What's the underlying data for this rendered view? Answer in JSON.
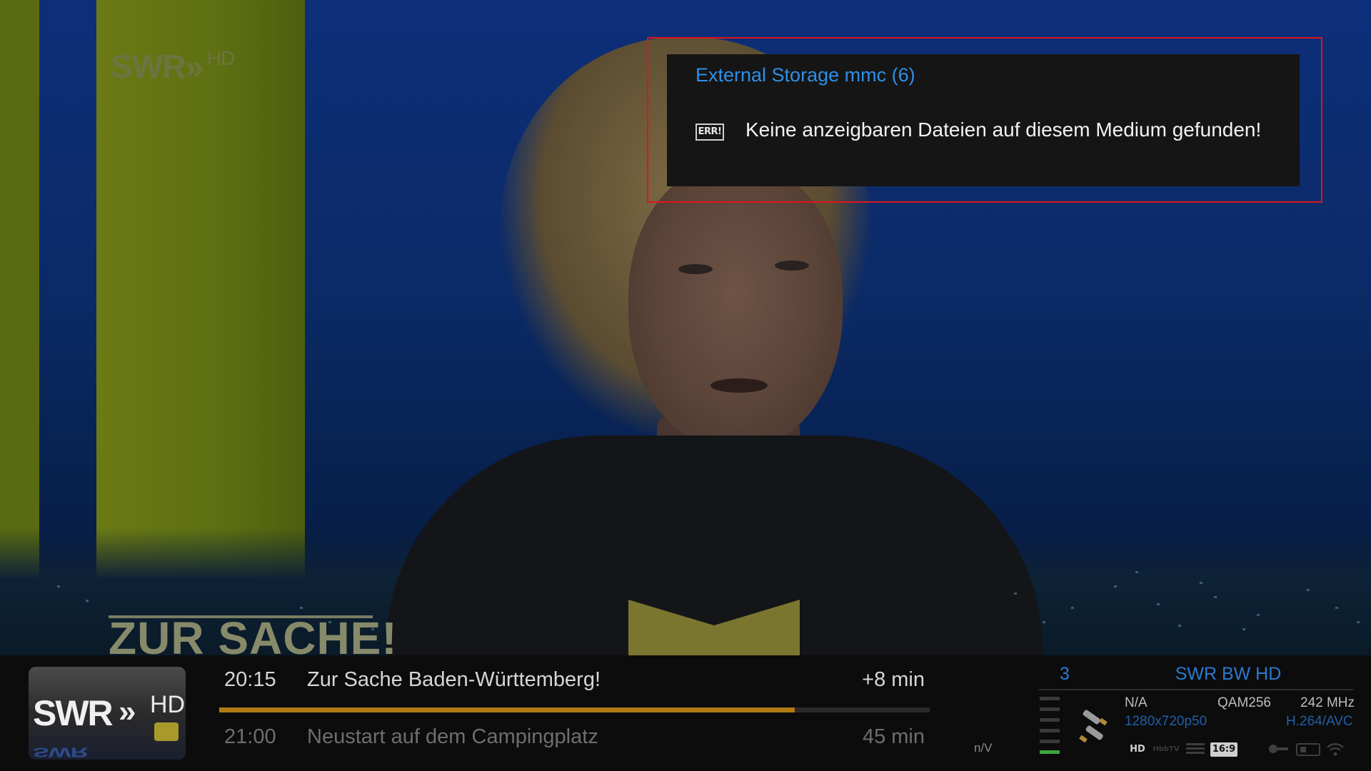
{
  "video": {
    "logo_text": "SWR",
    "logo_suffix": "HD",
    "show_banner": "ZUR SACHE!"
  },
  "popup": {
    "title": "External Storage mmc (6)",
    "icon": "ERR!",
    "message": "Keine anzeigbaren Dateien auf diesem Medium gefunden!",
    "highlight_color": "#e0151b",
    "title_color": "#2f8fe6"
  },
  "infobar": {
    "channel_logo": {
      "text": "SWR",
      "suffix": "HD"
    },
    "now": {
      "time": "20:15",
      "title": "Zur Sache Baden-Württemberg!",
      "remaining": "+8 min"
    },
    "next": {
      "time": "21:00",
      "title": "Neustart auf dem Campingplatz",
      "duration": "45 min"
    },
    "progress_fraction": 0.81,
    "progress_color": "#b07a14",
    "nv_label": "n/V",
    "channel_number": "3",
    "channel_name": "SWR BW HD",
    "signal_level_fraction": 0.17,
    "tech": {
      "service": "N/A",
      "modulation": "QAM256",
      "frequency": "242 MHz",
      "resolution": "1280x720p50",
      "codec": "H.264/AVC"
    },
    "status_icons": [
      "HD",
      "HbbTV",
      "txt",
      "16:9",
      "key",
      "cam",
      "wifi"
    ]
  }
}
